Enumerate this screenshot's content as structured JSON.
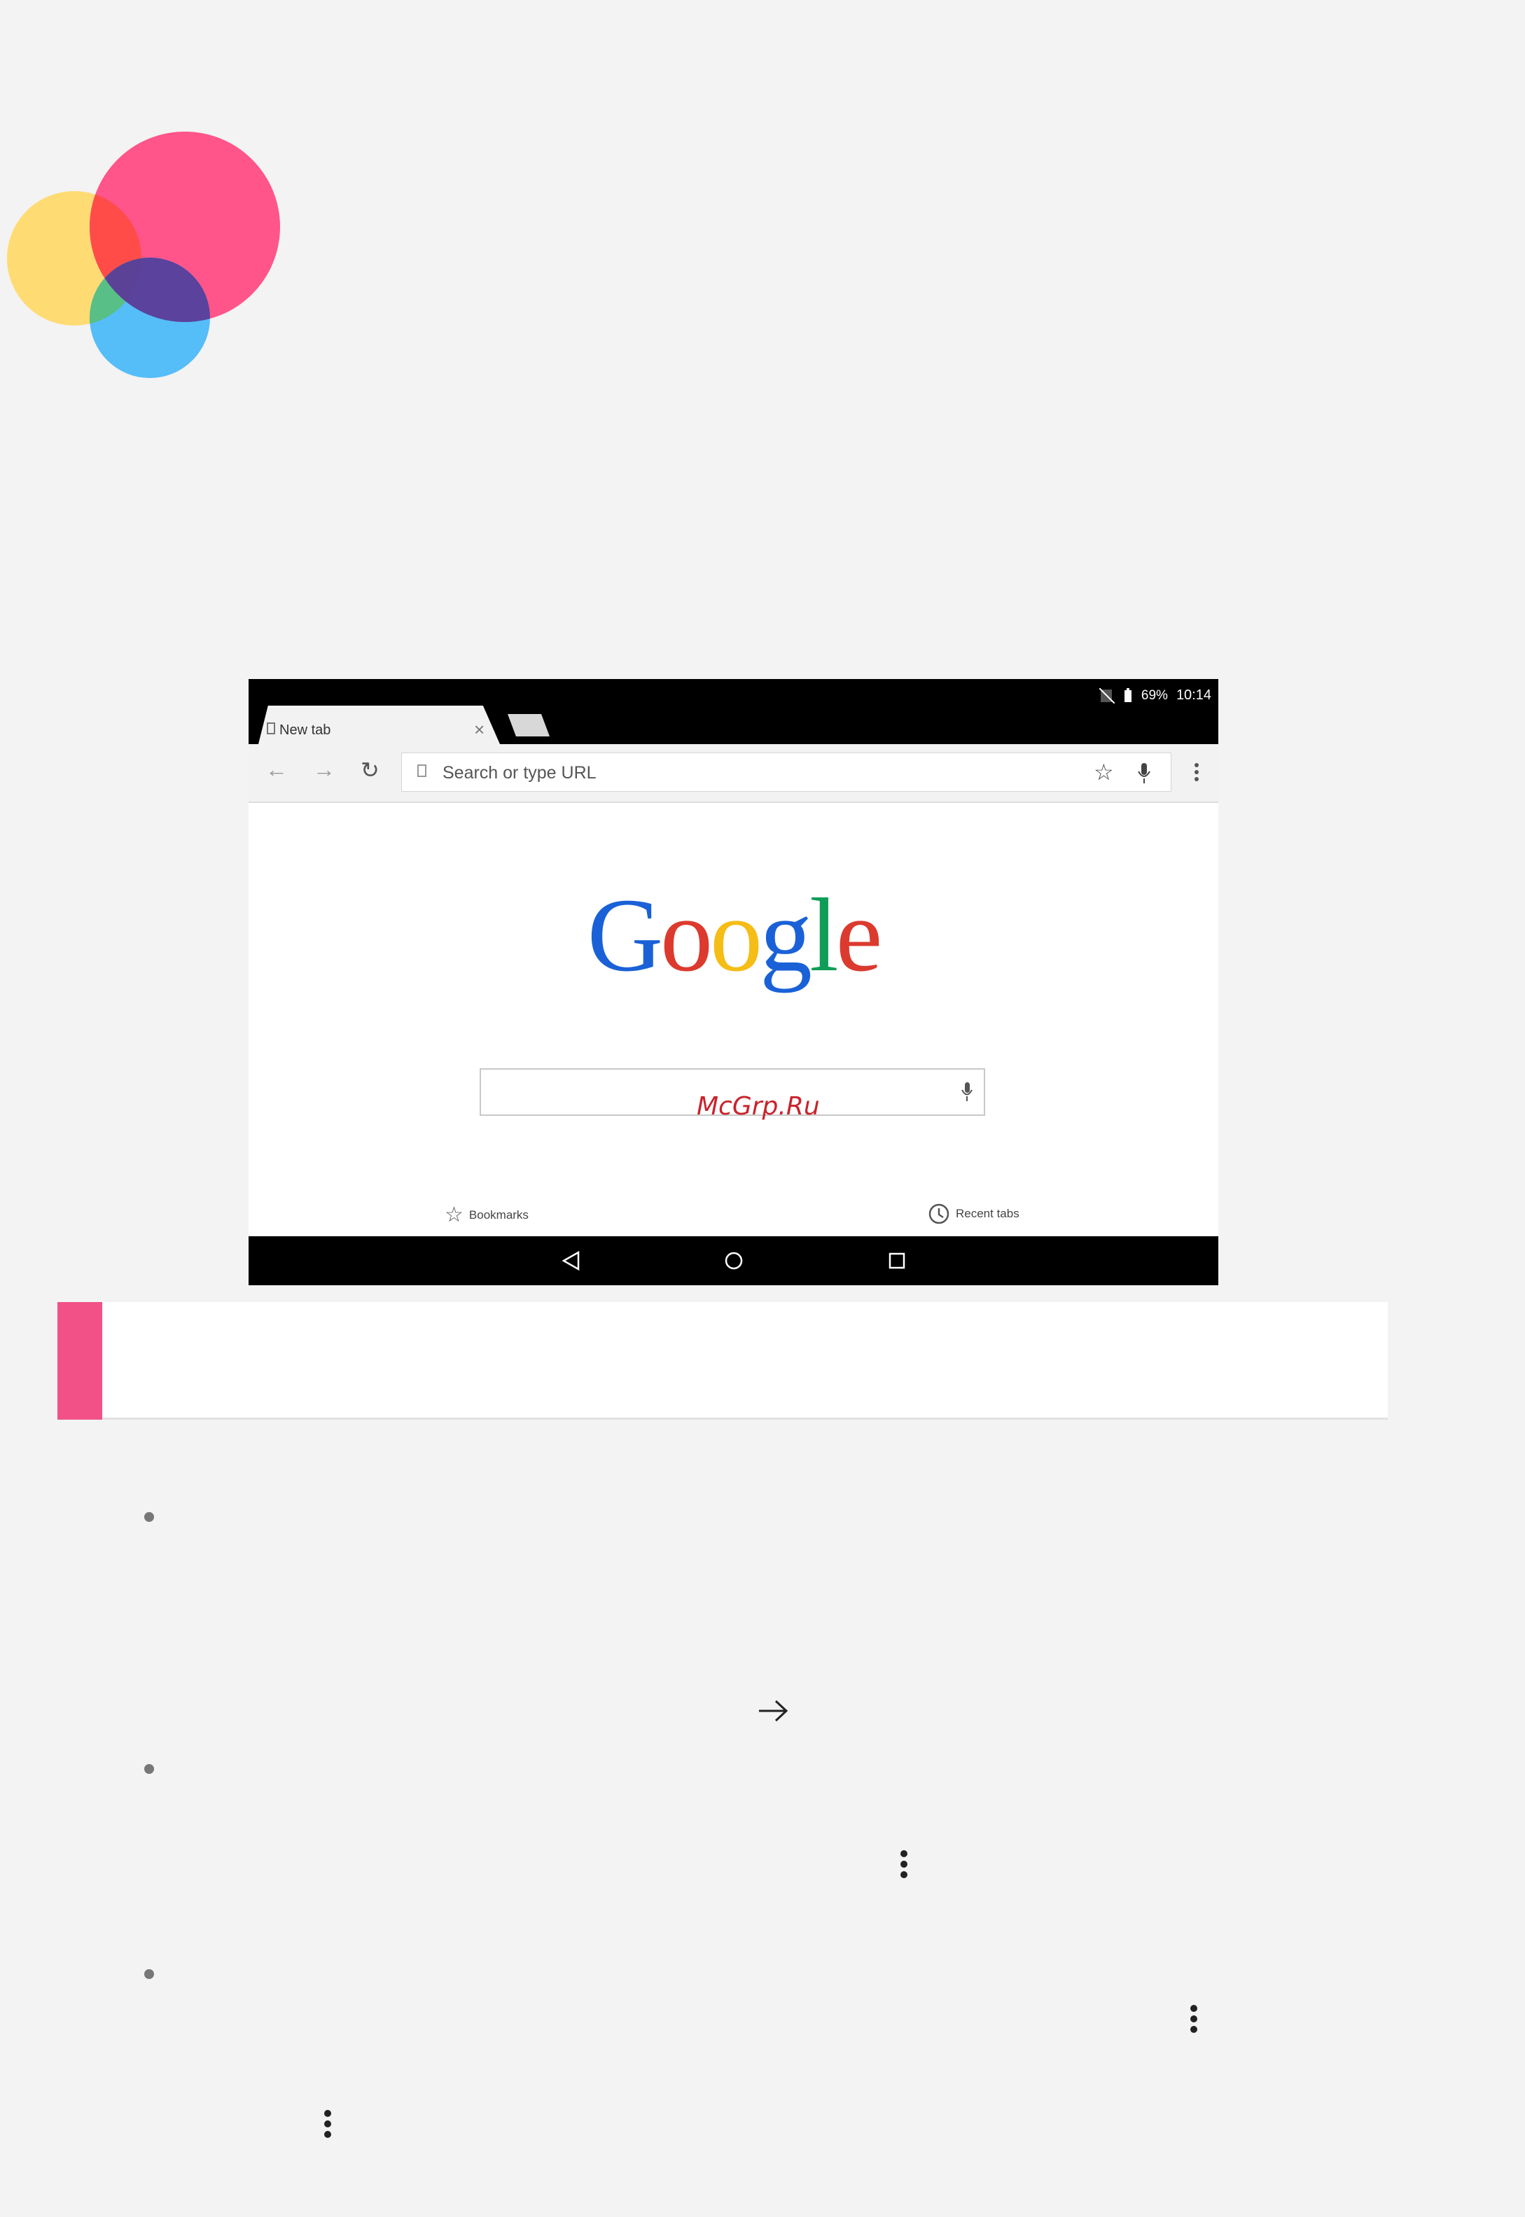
{
  "browser": {
    "status": {
      "battery": "69%",
      "time": "10:14"
    },
    "tab": {
      "label": "New tab"
    },
    "omnibox": {
      "placeholder": "Search or type URL"
    },
    "logo_text": [
      "G",
      "o",
      "o",
      "g",
      "l",
      "e"
    ],
    "logo_colors": [
      "#1a61d8",
      "#dc3a2e",
      "#f5bd15",
      "#1a61d8",
      "#0f9d58",
      "#dc3a2e"
    ],
    "footer": {
      "bookmarks": "Bookmarks",
      "recent_tabs": "Recent tabs"
    }
  },
  "watermark": "McGrp.Ru",
  "colors": {
    "accent": "#f25188",
    "circle_pink": "#ff4d84",
    "circle_yellow": "#ffd76a",
    "circle_blue": "#4bb8f5"
  }
}
